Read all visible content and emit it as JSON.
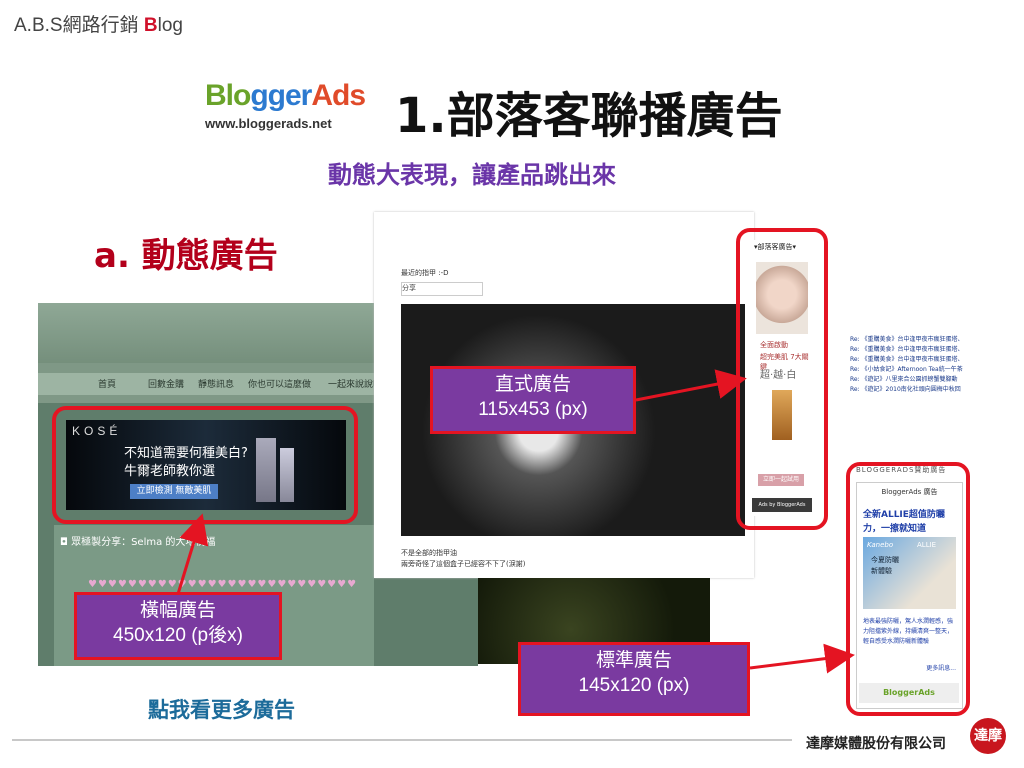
{
  "header": {
    "brand_prefix": "A.B.S網路行銷 ",
    "brand_b": "B",
    "brand_suffix": "log"
  },
  "logo": {
    "part1": "Blo",
    "part2": "gger",
    "part3": "Ads",
    "url": "www.bloggerads.net"
  },
  "title": "1.部落客聯播廣告",
  "subtitle": "動態大表現，讓產品跳出來",
  "section_heading": "a. 動態廣告",
  "left_screenshot": {
    "nav": [
      "首頁",
      "回數金購",
      "靜態訊息",
      "你也可以這麼做",
      "一起來說說吧"
    ],
    "banner": {
      "brand": "KOSÉ",
      "line1": "不知道需要何種美白?",
      "line2": "牛爾老師教你選",
      "cta": "立即檢測 無敵美肌"
    },
    "post_title": "◘ 眾極製分享：Selma 的大地祝福",
    "dots": "♥♥♥♥♥♥♥♥♥♥♥♥♥♥♥♥♥♥♥♥♥♥♥♥♥♥♥"
  },
  "middle_screenshot": {
    "post_title": "最近的指甲 :-D",
    "share_label": "分享",
    "caption1": "不是全部的指甲油",
    "caption2": "兩旁奇怪了這個盒子已經容不下了(淚謝)"
  },
  "vertical_ad": {
    "header": "▾部落客廣告▾",
    "tag1": "全面啟動",
    "tag2": "超完美肌 7大關鍵",
    "tag3": "超‧越‧白",
    "button": "立即一起試用",
    "footer": "Ads by BloggerAds"
  },
  "sidebar_links": [
    "Re: 《重購美食》台中逢甲夜市瘋狂蛋塔、",
    "Re: 《重購美食》台中逢甲夜市瘋狂蛋塔、",
    "Re: 《重購美食》台中逢甲夜市瘋狂蛋塔、",
    "Re: 《小姑食記》Afternoon Tea統一午茶",
    "Re: 《遊記》八里來合公園抓螃蟹雙腳動",
    "Re: 《遊記》2010南化社頭向圓梅中秋回"
  ],
  "standard_ad": {
    "section_header": "BLOGGERADS贊助廣告",
    "header": "BloggerAds 廣告",
    "title1": "全新ALLIE超值防曬",
    "title2": "力，一擦就知道",
    "brand1": "Kanebo",
    "brand2": "ALLIE",
    "pic_text1": "今夏防曬",
    "pic_text2": "新體驗",
    "description": "地表最強防曬，駕人水潤輕感，強力阻擋紫外線，持續清爽一整天，輕自感受水潤防曬新體驗",
    "more": "更多訊息...",
    "footer": "BloggerAds"
  },
  "labels": {
    "vertical": {
      "line1": "直式廣告",
      "line2": "115x453 (px)"
    },
    "banner": {
      "line1": "橫幅廣告",
      "line2": "450x120 (p後x)"
    },
    "standard": {
      "line1": "標準廣告",
      "line2": "145x120 (px)"
    }
  },
  "more_ads_link": "點我看更多廣告",
  "footer": {
    "company": "達摩媒體股份有限公司",
    "logo_text": "達摩"
  },
  "colors": {
    "accent_red": "#e41422",
    "label_purple": "#7a3aa0",
    "title_red": "#b3001b",
    "subtitle_purple": "#6a35a8"
  }
}
